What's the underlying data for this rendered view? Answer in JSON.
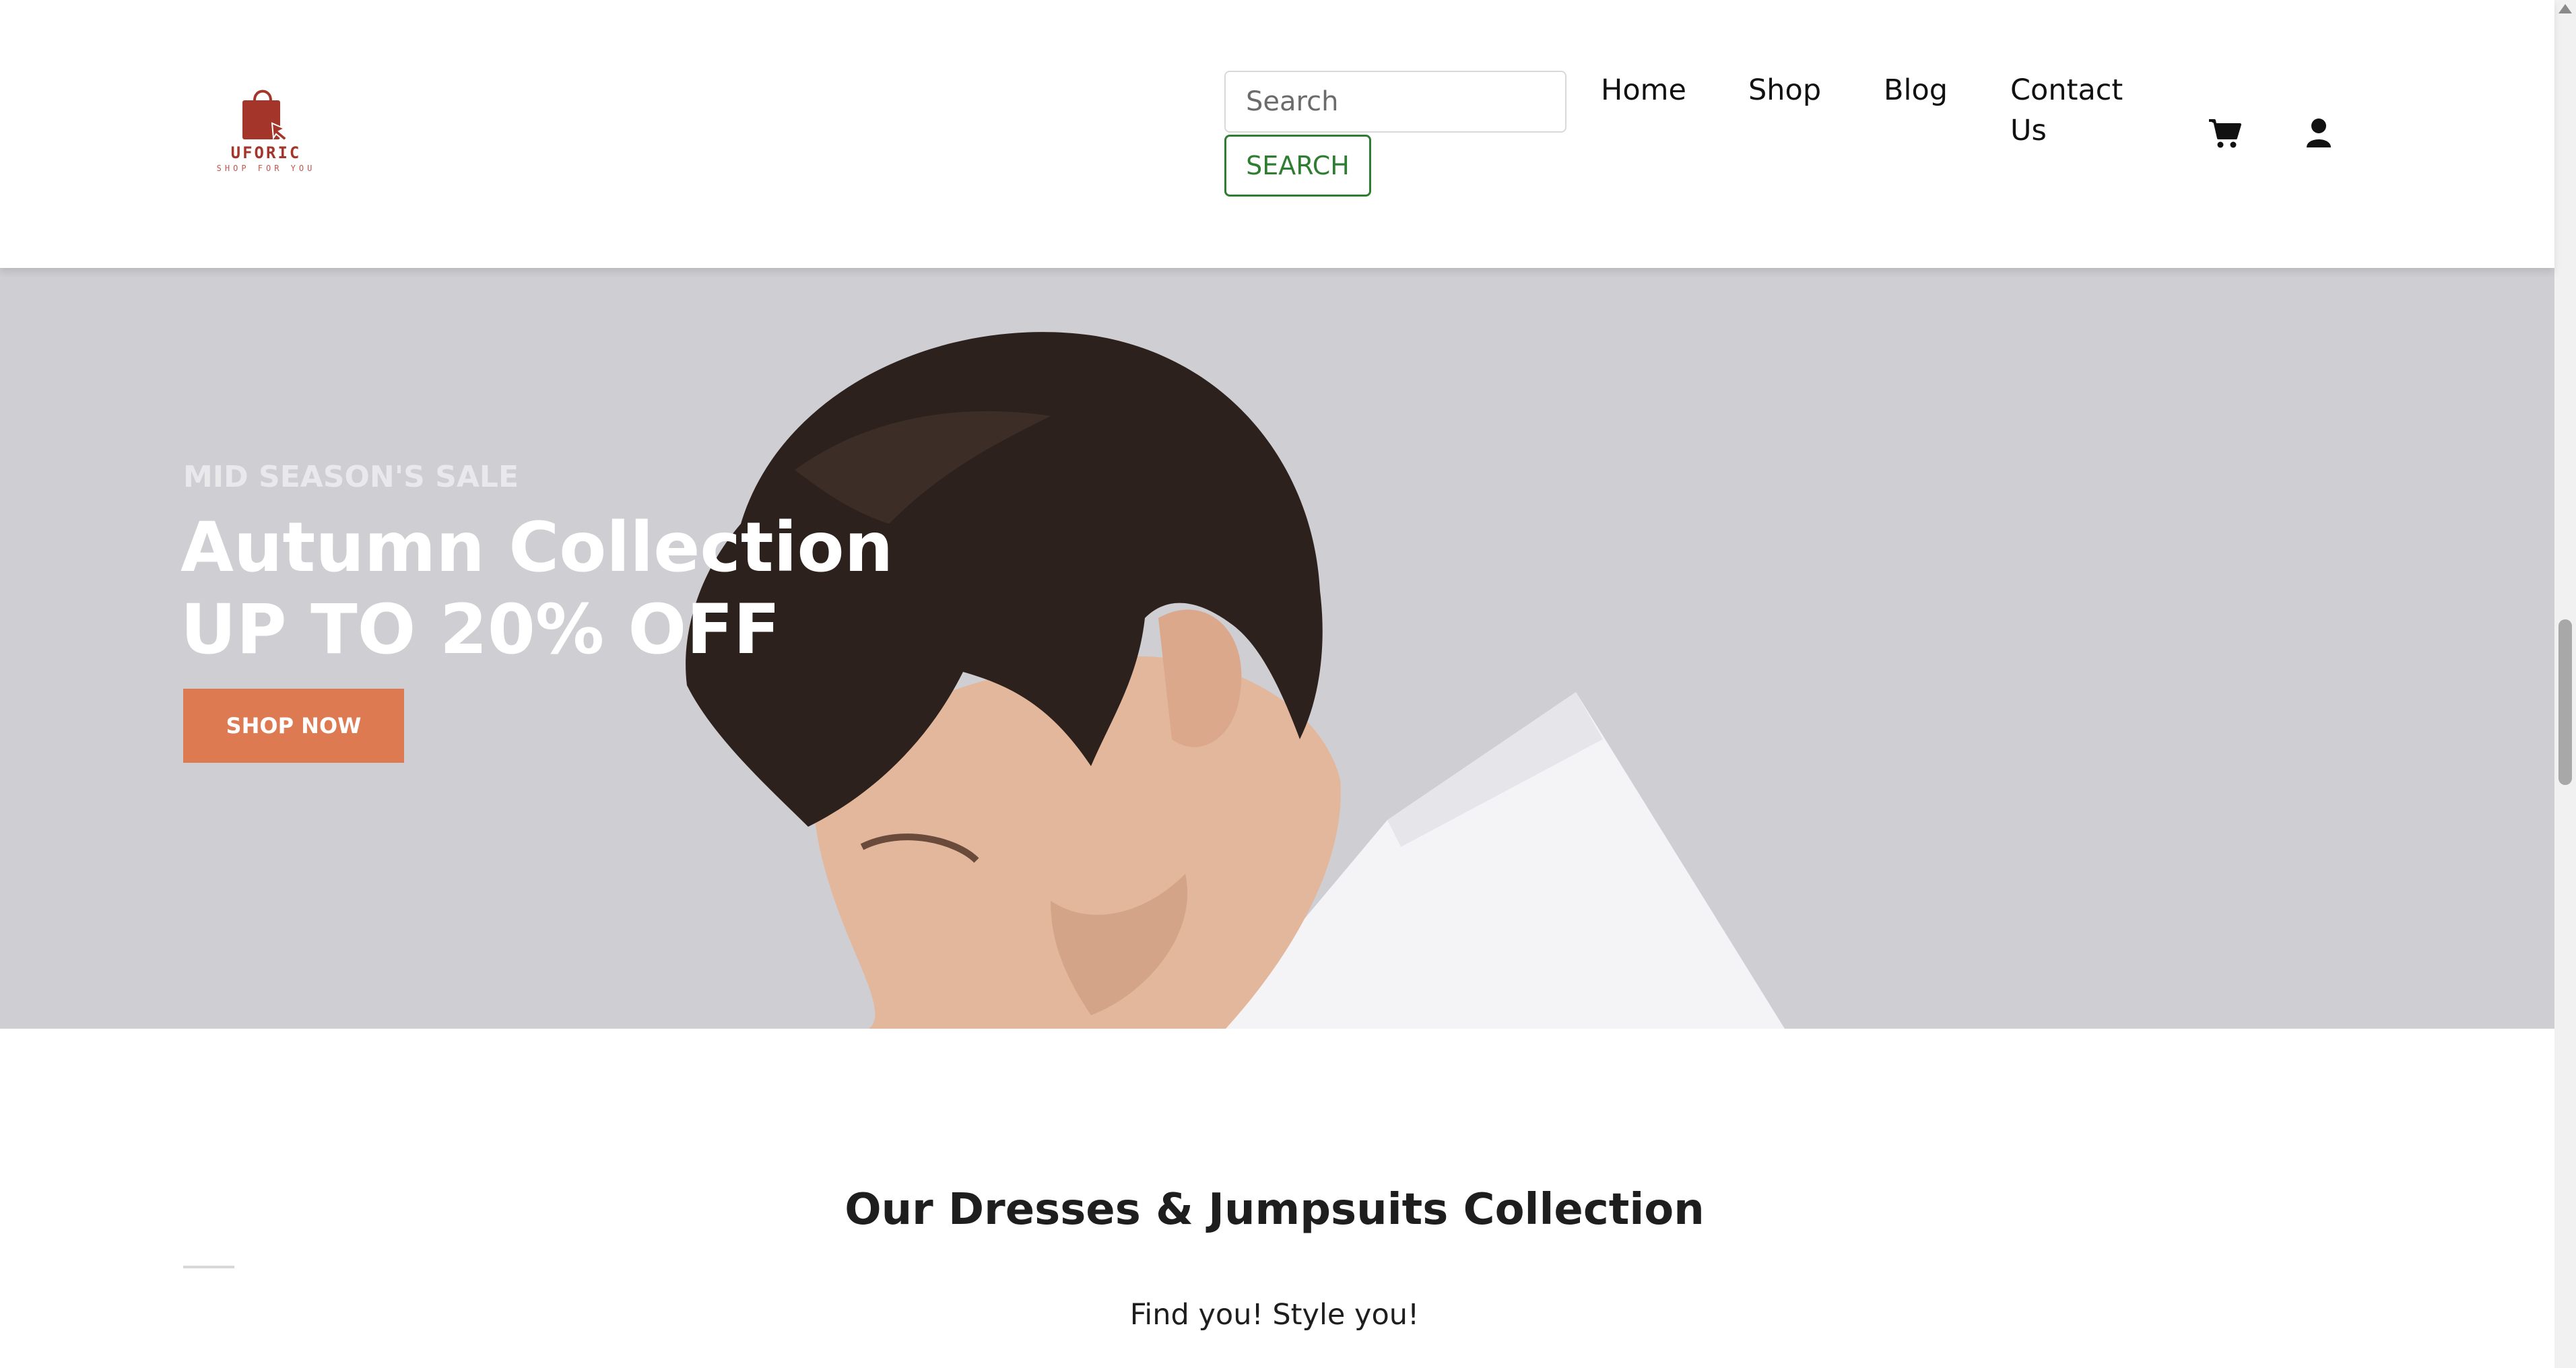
{
  "header": {
    "logo": {
      "brand": "UFORIC",
      "tagline": "SHOP FOR YOU",
      "color": "#a3352b"
    },
    "search": {
      "placeholder": "Search",
      "button_label": "SEARCH"
    },
    "nav": [
      {
        "label": "Home"
      },
      {
        "label": "Shop"
      },
      {
        "label": "Blog"
      },
      {
        "label": "Contact Us"
      }
    ],
    "icons": [
      "cart-icon",
      "user-icon"
    ]
  },
  "hero": {
    "kicker": "MID SEASON'S SALE",
    "title_line1": "Autumn Collection",
    "title_line2": "UP TO 20% OFF",
    "cta_label": "SHOP NOW",
    "cta_color": "#dd7a52"
  },
  "collection": {
    "title": "Our Dresses & Jumpsuits Collection",
    "subtitle": "Find you! Style you!"
  },
  "colors": {
    "accent_green": "#2f7d32",
    "hero_bg": "#cfced3"
  }
}
